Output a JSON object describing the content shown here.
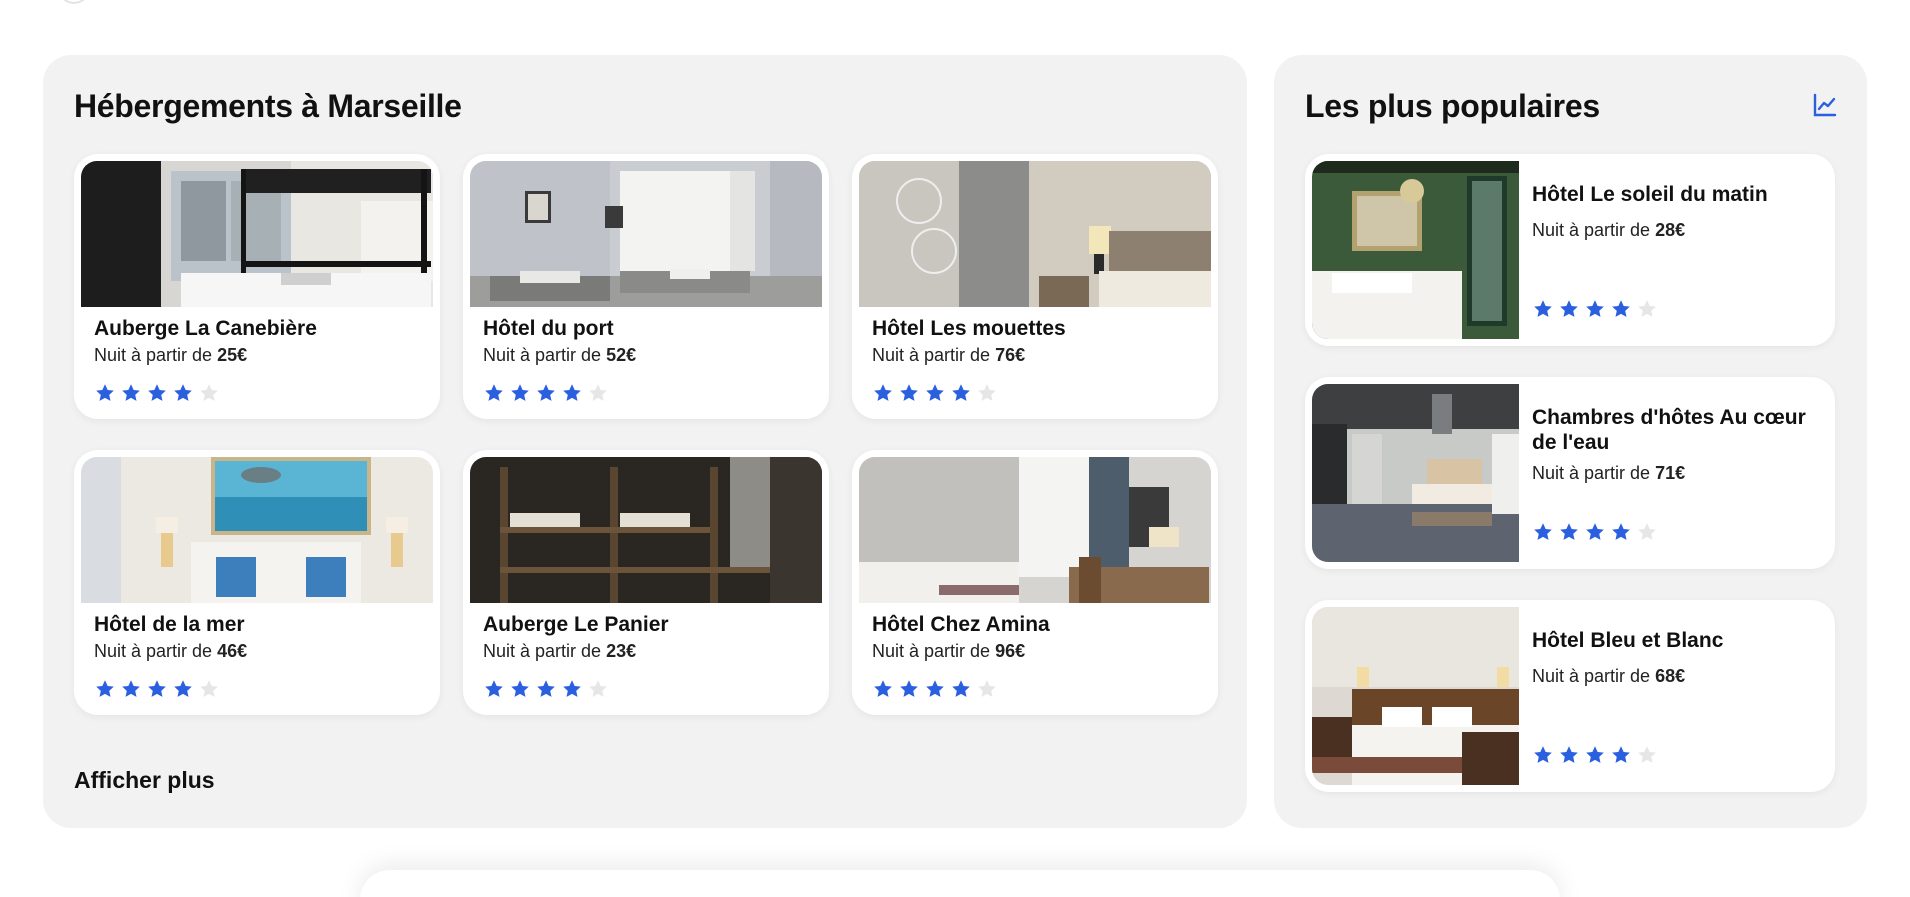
{
  "colors": {
    "star_filled": "#2a5fe0",
    "star_empty": "#e6e6e6",
    "accent": "#2a5fe0",
    "panel_bg": "#f2f2f2"
  },
  "main": {
    "title": "Hébergements à Marseille",
    "show_more": "Afficher plus",
    "price_prefix": "Nuit à partir de ",
    "cards": [
      {
        "name": "Auberge La Canebière",
        "price": "25€",
        "rating": 4,
        "max_rating": 5
      },
      {
        "name": "Hôtel du port",
        "price": "52€",
        "rating": 4,
        "max_rating": 5
      },
      {
        "name": "Hôtel Les mouettes",
        "price": "76€",
        "rating": 4,
        "max_rating": 5
      },
      {
        "name": "Hôtel de la mer",
        "price": "46€",
        "rating": 4,
        "max_rating": 5
      },
      {
        "name": "Auberge Le Panier",
        "price": "23€",
        "rating": 4,
        "max_rating": 5
      },
      {
        "name": "Hôtel Chez Amina",
        "price": "96€",
        "rating": 4,
        "max_rating": 5
      }
    ]
  },
  "side": {
    "title": "Les plus populaires",
    "icon": "trending-chart-icon",
    "price_prefix": "Nuit à partir de ",
    "cards": [
      {
        "name": "Hôtel Le soleil du matin",
        "price": "28€",
        "rating": 4,
        "max_rating": 5
      },
      {
        "name": "Chambres d'hôtes Au cœur de l'eau",
        "price": "71€",
        "rating": 4,
        "max_rating": 5
      },
      {
        "name": "Hôtel Bleu et Blanc",
        "price": "68€",
        "rating": 4,
        "max_rating": 5
      }
    ]
  }
}
